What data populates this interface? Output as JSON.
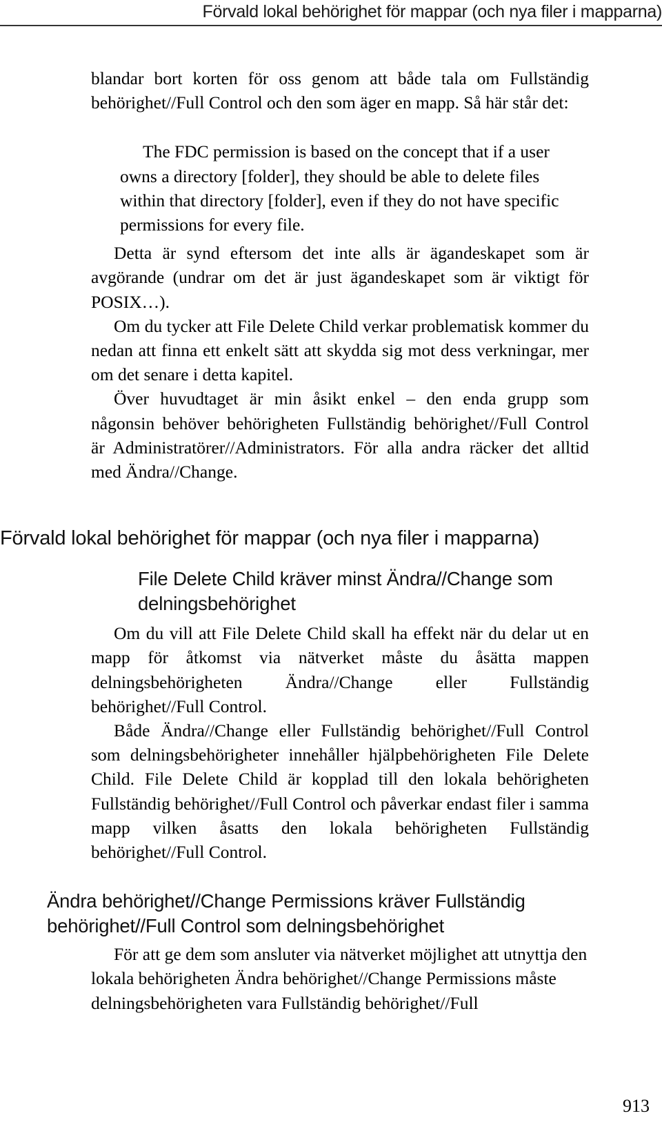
{
  "header": {
    "running_head": "Förvald lokal behörighet för mappar (och nya filer i mapparna)"
  },
  "body": {
    "paragraph_1": "blandar bort korten för oss genom att både tala om Fullständig behörighet//Full Control och den som äger en mapp. Så här står det:",
    "quote_1": "The FDC permission is based on the concept that if a user owns a directory [folder], they should be able to delete files within that directory [folder], even if they do not have specific permissions for every file.",
    "paragraph_2": "Detta är synd eftersom det inte alls är ägandeskapet som är avgörande (undrar om det är just ägandeskapet som är viktigt för POSIX…).",
    "paragraph_3": "Om du tycker att File Delete Child verkar problematisk kommer du nedan att finna ett enkelt sätt att skydda sig mot dess verkningar, mer om det senare i detta kapitel.",
    "paragraph_4": "Över huvudtaget är min åsikt enkel – den enda grupp som någonsin behöver behörigheten Fullständig behörighet//Full Control är Administratörer//Administrators. För alla andra räcker det alltid med Ändra//Change.",
    "paragraph_5": "Om du vill att File Delete Child skall ha effekt när du delar ut en mapp för åtkomst via nätverket måste du åsätta mappen delningsbehörigheten Ändra//Change eller Fullständig behörighet//Full Control.",
    "paragraph_6": "Både Ändra//Change eller Fullständig behörighet//Full Control som delningsbehörigheter innehåller hjälpbehörigheten File Delete Child. File Delete Child är kopplad till den lokala behörigheten Fullständig behörighet//Full Control och påverkar endast filer i samma mapp vilken åsatts den lokala behörigheten Fullständig behörighet//Full Control.",
    "paragraph_7": "För att ge dem som ansluter via nätverket möjlighet att utnyttja den lokala behörigheten Ändra behörighet//Change Permissions måste delningsbehörigheten vara Fullständig behörighet//Full"
  },
  "headings": {
    "chapter": "Förvald lokal behörighet för mappar (och nya filer i mapparna)",
    "section_1": "File Delete Child kräver minst Ändra//Change som delningsbehörighet",
    "section_2": "Ändra behörighet//Change Permissions kräver Fullständig behörighet//Full Control som delningsbehörighet"
  },
  "footer": {
    "page_number": "913"
  }
}
